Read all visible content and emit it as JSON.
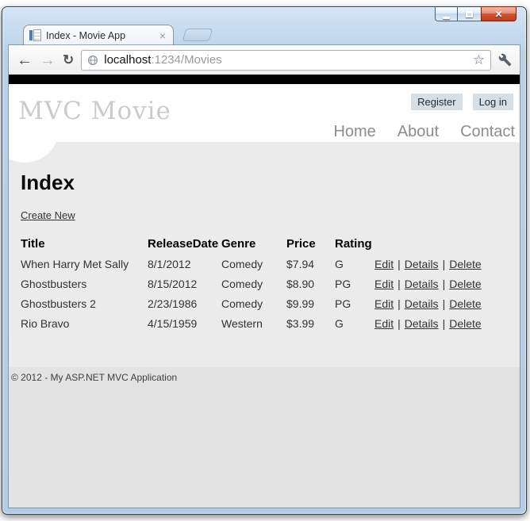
{
  "browser": {
    "window_controls": {
      "close_glyph": "✕"
    },
    "tab": {
      "title": "Index - Movie App",
      "close_glyph": "×",
      "favicon": "aspnet-page-icon"
    },
    "toolbar": {
      "back_glyph": "←",
      "forward_glyph": "→",
      "reload_glyph": "↻",
      "star_glyph": "☆",
      "url_host": "localhost",
      "url_rest": ":1234/Movies"
    }
  },
  "page": {
    "logo": "MVC Movie",
    "auth": {
      "register_label": "Register",
      "login_label": "Log in"
    },
    "nav": [
      {
        "label": "Home"
      },
      {
        "label": "About"
      },
      {
        "label": "Contact"
      }
    ],
    "heading": "Index",
    "create_link_label": "Create New",
    "table": {
      "headers": [
        "Title",
        "ReleaseDate",
        "Genre",
        "Price",
        "Rating"
      ],
      "rows": [
        {
          "title": "When Harry Met Sally",
          "release_date": "8/1/2012",
          "genre": "Comedy",
          "price": "$7.94",
          "rating": "G"
        },
        {
          "title": "Ghostbusters",
          "release_date": "8/15/2012",
          "genre": "Comedy",
          "price": "$8.90",
          "rating": "PG"
        },
        {
          "title": "Ghostbusters 2",
          "release_date": "2/23/1986",
          "genre": "Comedy",
          "price": "$9.99",
          "rating": "PG"
        },
        {
          "title": "Rio Bravo",
          "release_date": "4/15/1959",
          "genre": "Western",
          "price": "$3.99",
          "rating": "G"
        }
      ],
      "actions": {
        "edit": "Edit",
        "details": "Details",
        "delete": "Delete",
        "separator": "|"
      }
    },
    "footer_text": "© 2012 - My ASP.NET MVC Application"
  },
  "colors": {
    "frame_blue": "#b9d1e8",
    "close_red": "#d05134",
    "black_bar": "#000000",
    "content_bg": "#ebebeb",
    "footer_bg": "#e3e3e3",
    "logo_gray": "#cbcbcb",
    "nav_gray": "#8d8d8d",
    "auth_button_bg": "#d7dee4",
    "link_text": "#333333"
  }
}
